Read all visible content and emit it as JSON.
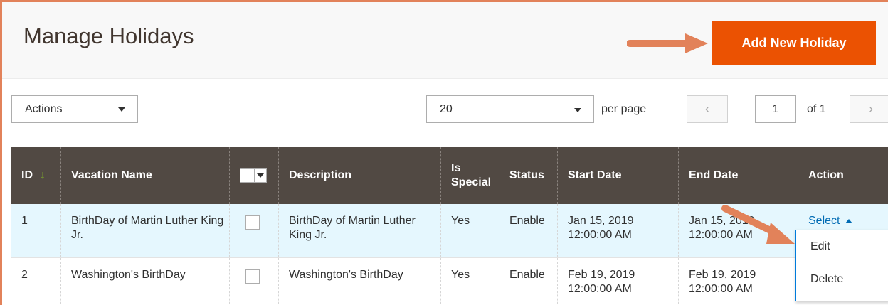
{
  "page": {
    "title": "Manage Holidays"
  },
  "header": {
    "add_button": "Add New Holiday"
  },
  "toolbar": {
    "actions_label": "Actions",
    "per_page_value": "20",
    "per_page_label": "per page",
    "page_current": "1",
    "page_total_label": "of 1",
    "prev_glyph": "‹",
    "next_glyph": "›"
  },
  "grid": {
    "columns": [
      "ID",
      "Vacation Name",
      "",
      "Description",
      "Is Special",
      "Status",
      "Start Date",
      "End Date",
      "Action"
    ],
    "sort_indicator": "↓",
    "rows": [
      {
        "id": "1",
        "name": "BirthDay of Martin Luther King Jr.",
        "description": "BirthDay of Martin Luther King Jr.",
        "is_special": "Yes",
        "status": "Enable",
        "start_date": "Jan 15, 2019",
        "start_time": "12:00:00 AM",
        "end_date": "Jan 15, 2019",
        "end_time": "12:00:00 AM",
        "action": "Select"
      },
      {
        "id": "2",
        "name": "Washington's BirthDay",
        "description": "Washington's BirthDay",
        "is_special": "Yes",
        "status": "Enable",
        "start_date": "Feb 19, 2019",
        "start_time": "12:00:00 AM",
        "end_date": "Feb 19, 2019",
        "end_time": "12:00:00 AM",
        "action": ""
      }
    ]
  },
  "action_menu": {
    "items": [
      "Edit",
      "Delete"
    ]
  },
  "colors": {
    "accent": "#eb5202",
    "header_bg": "#514943",
    "link": "#006bb4",
    "annotation_arrow": "#e2825a"
  }
}
